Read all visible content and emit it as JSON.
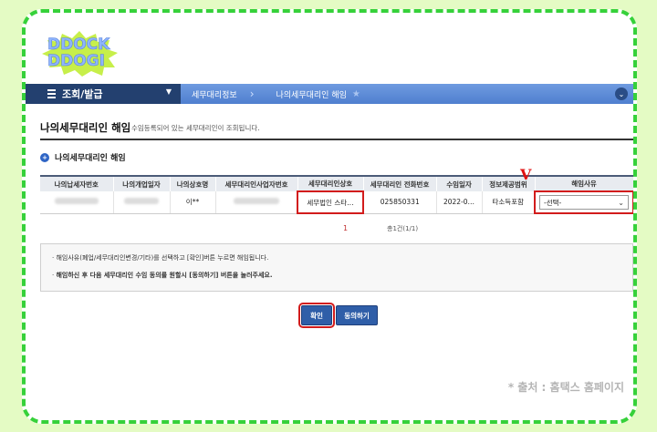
{
  "logo": {
    "line1": "DDOCK",
    "line2": "DDOGI"
  },
  "nav": {
    "menu_label": "조회/발급",
    "breadcrumb": [
      "세무대리정보",
      "나의세무대리인 해임"
    ]
  },
  "page": {
    "title": "나의세무대리인 해임",
    "description": "수임등록되어 있는 세무대리인이 조회됩니다."
  },
  "section": {
    "title": "나의세무대리인 해임"
  },
  "table": {
    "headers": [
      "나의납세자번호",
      "나의개업일자",
      "나의상호명",
      "세무대리인사업자번호",
      "세무대리인상호",
      "세무대리인 전화번호",
      "수임일자",
      "정보제공범위",
      "해임사유"
    ],
    "row": {
      "trade_name": "이**",
      "agent_name": "세무법인 스타…",
      "agent_phone": "025850331",
      "appointment_date": "2022-0…",
      "scope": "타소득포함",
      "reason_selected": "-선택-"
    }
  },
  "mark": "V",
  "pager": {
    "page": "1",
    "count": "총1건(1/1)"
  },
  "notice": {
    "line1": "해임사유(폐업/세무대리인변경/기타)를 선택하고 [확인]버튼 누르면 해임됩니다.",
    "line2": "해임하신 후 다음 세무대리인 수임 동의를 원할시 [동의하기] 버튼을 눌러주세요."
  },
  "buttons": {
    "confirm": "확인",
    "agree": "동의하기"
  },
  "credit": "* 출처 : 홈택스 홈페이지",
  "colors": {
    "nav_dark": "#23406f",
    "nav_light": "#6f9be0",
    "highlight": "#d21c1c",
    "frame_border": "#36d13a",
    "background": "#e4fbc4"
  }
}
